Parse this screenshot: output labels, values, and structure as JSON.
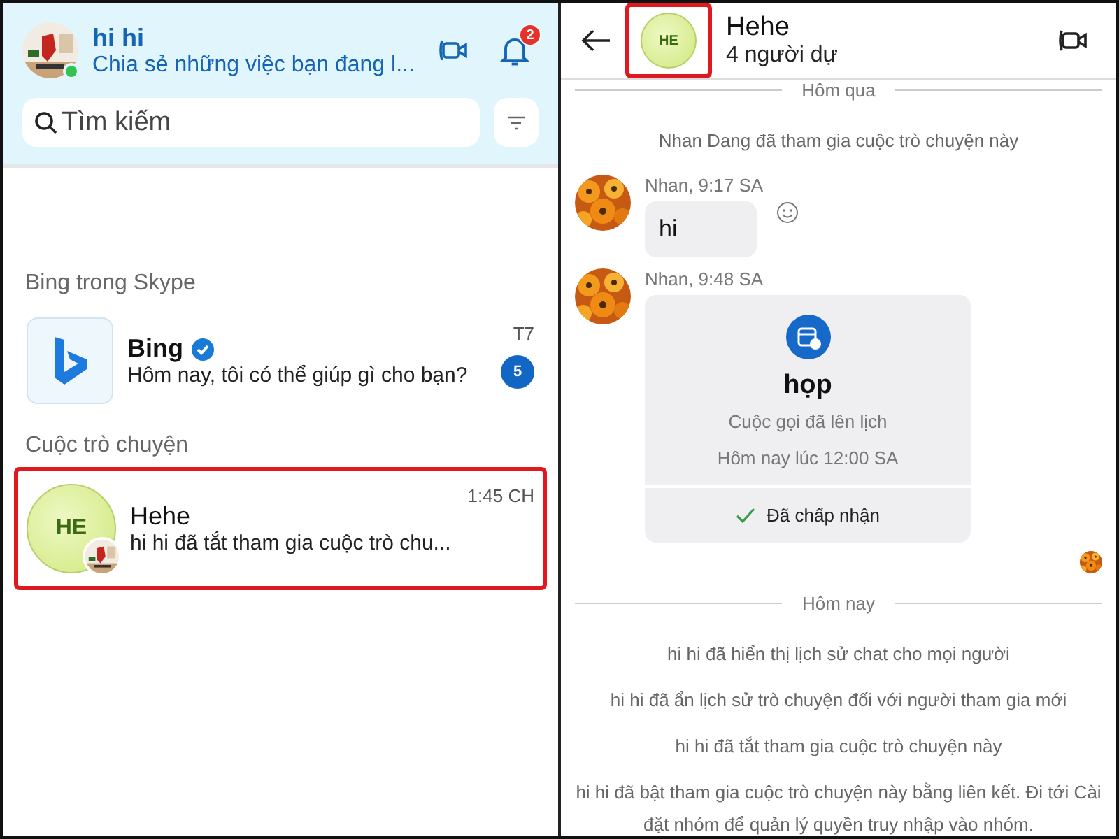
{
  "left": {
    "profile": {
      "name": "hi hi",
      "status": "Chia sẻ những việc bạn đang l...",
      "online": true
    },
    "notifications": {
      "count": "2"
    },
    "search": {
      "placeholder": "Tìm kiếm"
    },
    "sections": [
      {
        "title": "Bing trong Skype",
        "items": [
          {
            "kind": "bot",
            "name": "Bing",
            "verified": true,
            "preview": "Hôm nay, tôi có thể giúp gì cho bạn?",
            "time": "T7",
            "unread": "5",
            "highlighted": false
          }
        ]
      },
      {
        "title": "Cuộc trò chuyện",
        "items": [
          {
            "kind": "group",
            "initials": "HE",
            "name": "Hehe",
            "verified": false,
            "preview": "hi hi đã tắt tham gia cuộc trò chu...",
            "time": "1:45 CH",
            "highlighted": true
          }
        ]
      }
    ]
  },
  "right": {
    "header": {
      "initials": "HE",
      "title": "Hehe",
      "subtitle": "4 người dự",
      "avatar_highlighted": true
    },
    "timeline": [
      {
        "kind": "divider",
        "text": "Hôm qua"
      },
      {
        "kind": "system",
        "text": "Nhan Dang đã tham gia cuộc trò chuyện này"
      },
      {
        "kind": "message",
        "meta": "Nhan, 9:17 SA",
        "text": "hi"
      },
      {
        "kind": "meeting",
        "meta": "Nhan, 9:48 SA",
        "title": "họp",
        "subtitle": "Cuộc gọi đã lên lịch",
        "time": "Hôm nay lúc 12:00 SA",
        "status": "Đã chấp nhận"
      },
      {
        "kind": "read_receipt"
      },
      {
        "kind": "divider",
        "text": "Hôm nay"
      },
      {
        "kind": "system",
        "text": "hi hi đã hiển thị lịch sử chat cho mọi người"
      },
      {
        "kind": "system",
        "text": "hi hi đã ẩn lịch sử trò chuyện đối với người tham gia mới"
      },
      {
        "kind": "system",
        "text": "hi hi đã tắt tham gia cuộc trò chuyện này"
      },
      {
        "kind": "system",
        "text": "hi hi đã bật tham gia cuộc trò chuyện này bằng liên kết. Đi tới Cài đặt nhóm để quản lý quyền truy nhập vào nhóm."
      }
    ]
  }
}
